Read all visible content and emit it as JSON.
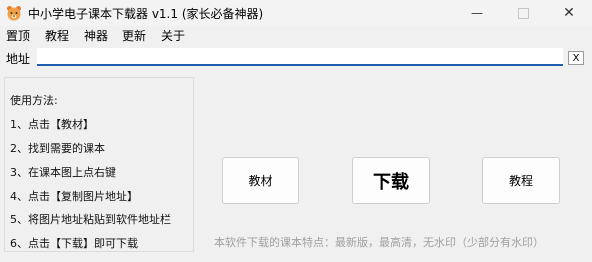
{
  "window": {
    "title": "中小学电子课本下载器  v1.1   (家长必备神器)",
    "icon": "bear-app-icon",
    "controls": {
      "minimize": "—",
      "maximize": "",
      "close": "✕"
    }
  },
  "menu": [
    "置顶",
    "教程",
    "神器",
    "更新",
    "关于"
  ],
  "address": {
    "label": "地址",
    "value": "",
    "clear_label": "X"
  },
  "help": [
    "使用方法:",
    "1、点击【教材】",
    "2、找到需要的课本",
    "3、在课本图上点右键",
    "4、点击【复制图片地址】",
    "5、将图片地址粘贴到软件地址栏",
    "6、点击【下载】即可下载"
  ],
  "buttons": {
    "textbook": "教材",
    "download": "下载",
    "tutorial": "教程"
  },
  "footer": "本软件下载的课本特点：最新版，最高清，无水印（少部分有水印）",
  "colors": {
    "input_underline": "#1f5fae",
    "footer_text": "#a0a0a0"
  }
}
